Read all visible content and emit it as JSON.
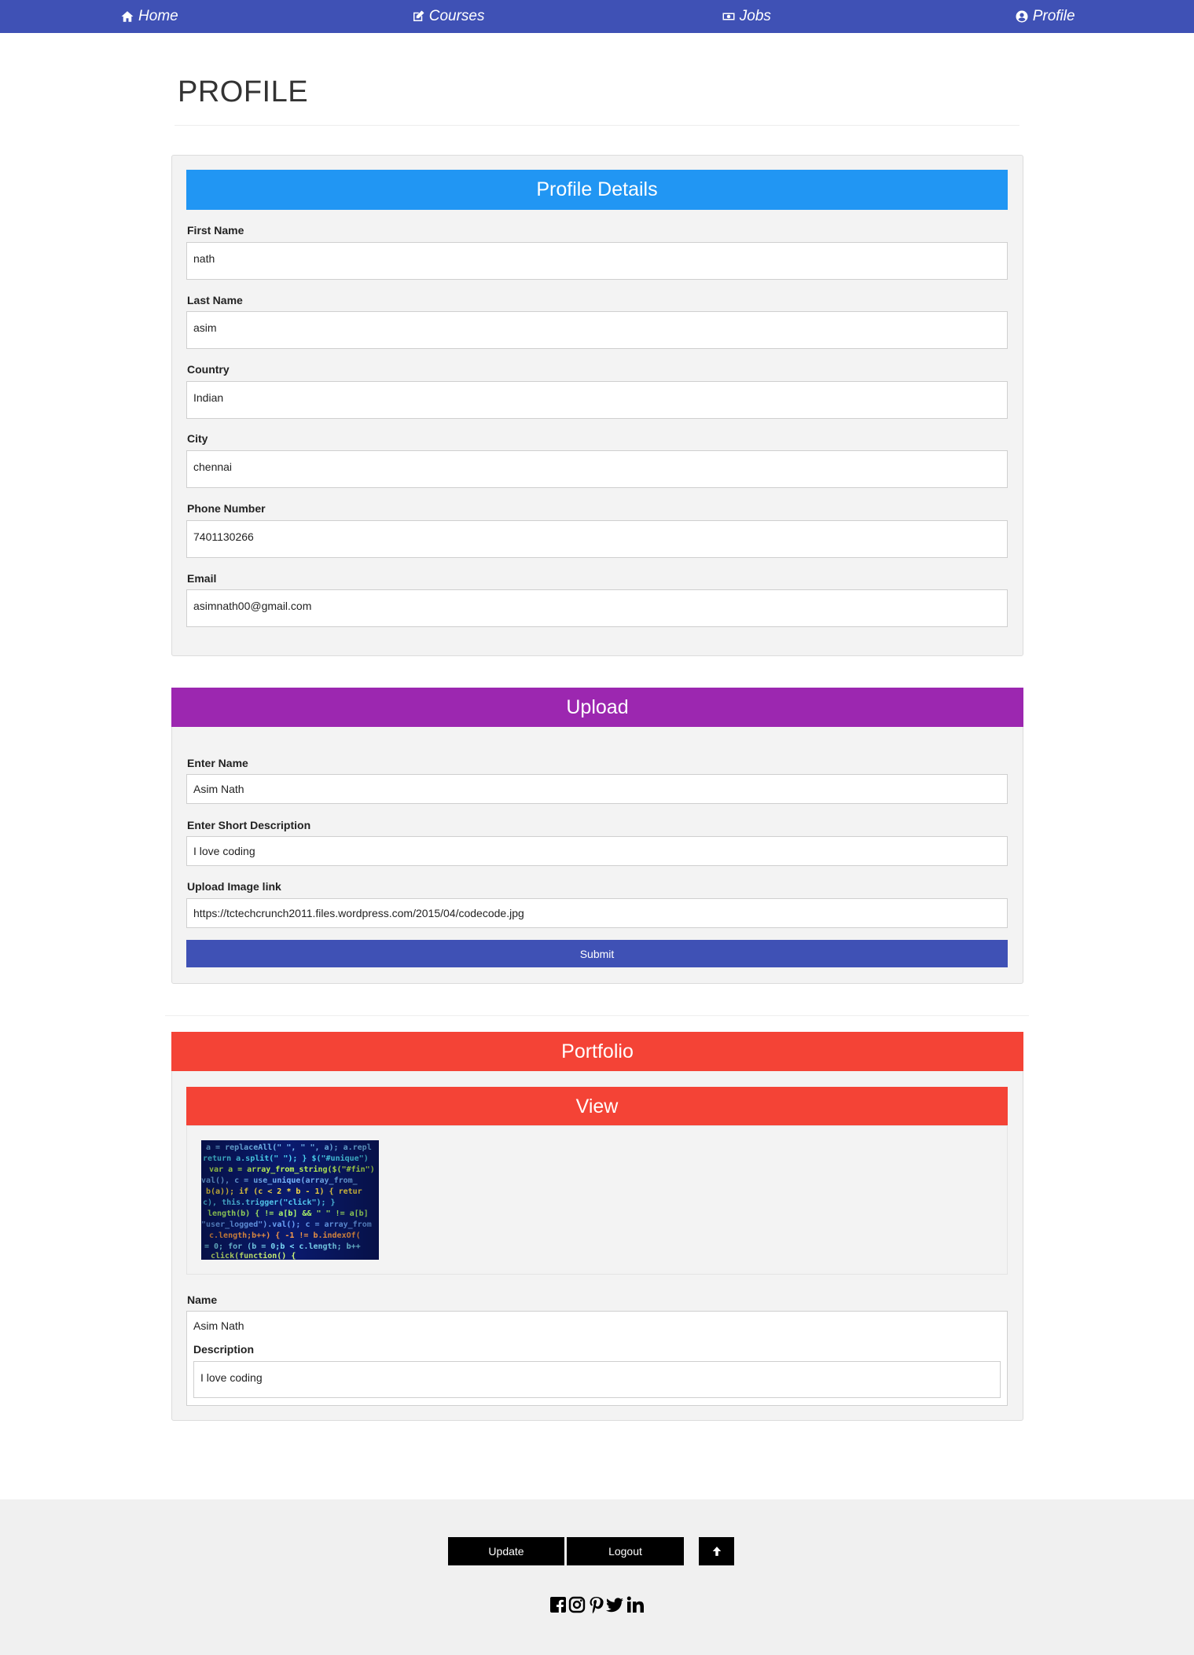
{
  "nav": {
    "home": "Home",
    "courses": "Courses",
    "jobs": "Jobs",
    "profile": "Profile",
    "icons": [
      "home-icon",
      "edit-icon",
      "money-icon",
      "user-circle-icon"
    ]
  },
  "page_title": "PROFILE",
  "profile_details": {
    "heading": "Profile Details",
    "first_name_label": "First Name",
    "first_name": "nath",
    "last_name_label": "Last Name",
    "last_name": "asim",
    "country_label": "Country",
    "country": "Indian",
    "city_label": "City",
    "city": "chennai",
    "phone_label": "Phone Number",
    "phone": "7401130266",
    "email_label": "Email",
    "email": "asimnath00@gmail.com"
  },
  "upload": {
    "heading": "Upload",
    "name_label": "Enter Name",
    "name_value": "Asim Nath",
    "desc_label": "Enter Short Description",
    "desc_value": "I love coding",
    "image_label": "Upload Image link",
    "image_value": "https://tctechcrunch2011.files.wordpress.com/2015/04/codecode.jpg",
    "submit": "Submit"
  },
  "portfolio": {
    "heading": "Portfolio",
    "view_heading": "View",
    "name_label": "Name",
    "name_value": "Asim Nath",
    "desc_label": "Description",
    "desc_value": "I love coding"
  },
  "footer": {
    "update": "Update",
    "logout": "Logout",
    "up_icon": "arrow-up-icon",
    "social_icons": [
      "facebook-icon",
      "instagram-icon",
      "pinterest-icon",
      "twitter-icon",
      "linkedin-icon"
    ]
  },
  "colors": {
    "nav": "#3f51b5",
    "profile_banner": "#2196f3",
    "upload_banner": "#9c27b0",
    "portfolio_banner": "#f44336",
    "submit": "#3f51b5"
  }
}
